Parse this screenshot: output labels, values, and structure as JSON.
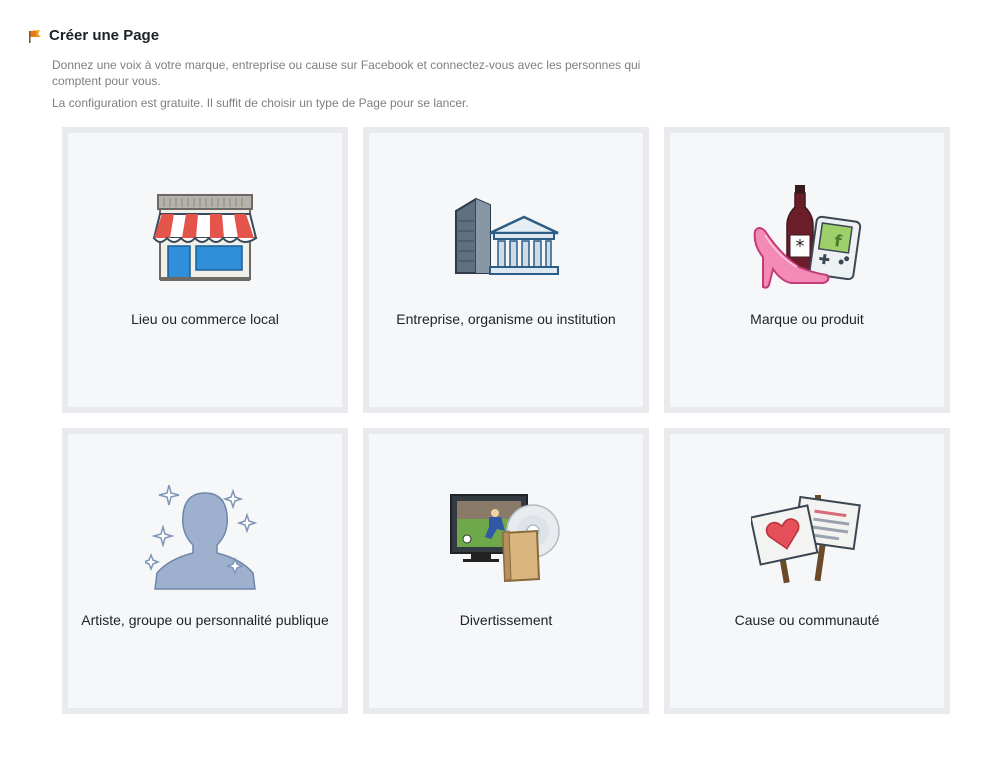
{
  "header": {
    "title": "Créer une Page",
    "icon": "page-flag-icon"
  },
  "description": {
    "line1": "Donnez une voix à votre marque, entreprise ou cause sur Facebook et connectez-vous avec les personnes qui comptent pour vous.",
    "line2": "La configuration est gratuite. Il suffit de choisir un type de Page pour se lancer."
  },
  "categories": [
    {
      "label": "Lieu ou commerce local",
      "icon": "storefront-icon"
    },
    {
      "label": "Entreprise, organisme ou institution",
      "icon": "buildings-icon"
    },
    {
      "label": "Marque ou produit",
      "icon": "brand-products-icon"
    },
    {
      "label": "Artiste, groupe ou personnalité publique",
      "icon": "celebrity-silhouette-icon"
    },
    {
      "label": "Divertissement",
      "icon": "entertainment-icon"
    },
    {
      "label": "Cause ou communauté",
      "icon": "protest-signs-icon"
    }
  ],
  "colors": {
    "tile_bg": "#f6f7f9",
    "tile_border": "#e9eaed",
    "title": "#1d2129",
    "muted": "#7f7f7f"
  }
}
